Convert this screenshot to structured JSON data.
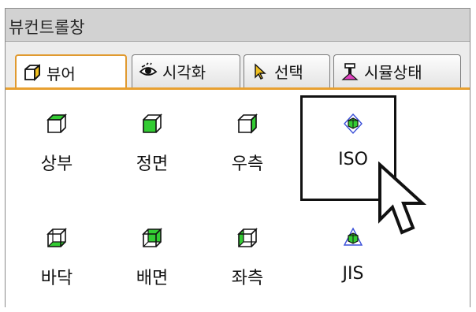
{
  "window": {
    "title": "뷰컨트롤창"
  },
  "tabs": [
    {
      "label": "뷰어",
      "icon": "cube-icon",
      "active": true
    },
    {
      "label": "시각화",
      "icon": "eye-icon",
      "active": false
    },
    {
      "label": "선택",
      "icon": "pointer-icon",
      "active": false
    },
    {
      "label": "시뮬상태",
      "icon": "simulation-icon",
      "active": false
    }
  ],
  "views": [
    {
      "label": "상부",
      "icon": "top-view-icon"
    },
    {
      "label": "정면",
      "icon": "front-view-icon"
    },
    {
      "label": "우측",
      "icon": "right-view-icon"
    },
    {
      "label": "ISO",
      "icon": "iso-view-icon",
      "highlighted": true
    },
    {
      "label": "바닥",
      "icon": "bottom-view-icon"
    },
    {
      "label": "배면",
      "icon": "back-view-icon"
    },
    {
      "label": "좌측",
      "icon": "left-view-icon"
    },
    {
      "label": "JIS",
      "icon": "jis-view-icon"
    }
  ],
  "colors": {
    "accent": "#e8a030",
    "face_green": "#33cc33",
    "iso_blue": "#3a4fd8"
  }
}
